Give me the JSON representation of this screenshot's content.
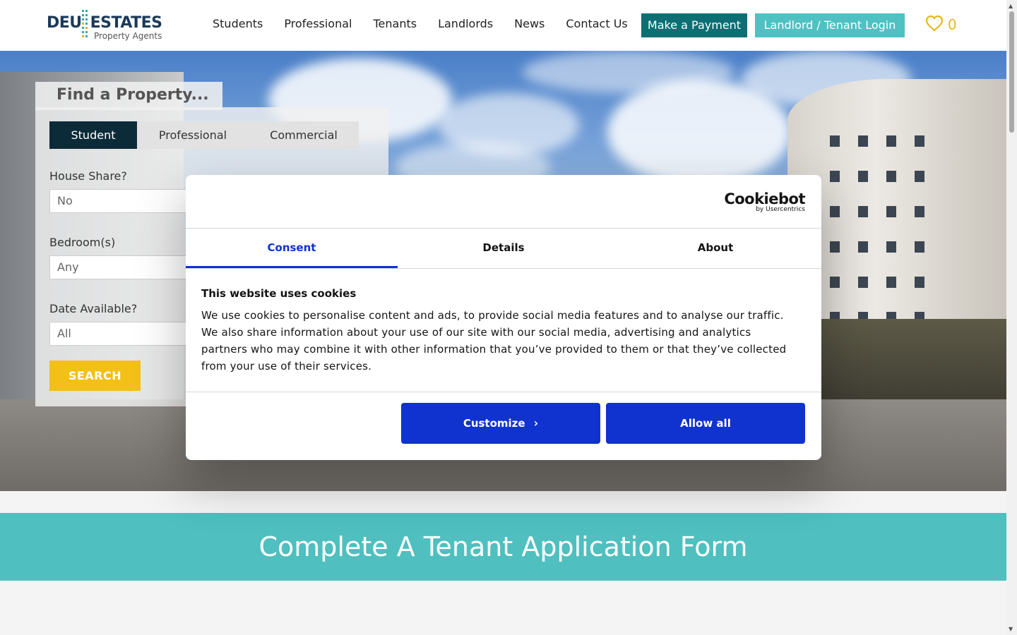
{
  "logo": {
    "left": "DEU",
    "right": "ESTATES",
    "subtitle": "Property Agents"
  },
  "nav": {
    "items": [
      "Students",
      "Professional",
      "Tenants",
      "Landlords",
      "News",
      "Contact Us"
    ],
    "pay_label": "Make a Payment",
    "login_label": "Landlord / Tenant Login",
    "favourites_count": "0"
  },
  "search": {
    "title": "Find a Property...",
    "tabs": [
      "Student",
      "Professional",
      "Commercial"
    ],
    "active_tab": "Student",
    "fields": [
      {
        "label": "House Share?",
        "value": "No"
      },
      {
        "label": "Bedroom(s)",
        "value": "Any"
      },
      {
        "label": "Date Available?",
        "value": "All"
      }
    ],
    "button_label": "SEARCH"
  },
  "band": {
    "title": "Complete A Tenant Application Form"
  },
  "cookie": {
    "brand": "Cookiebot",
    "brand_sub": "by Usercentrics",
    "tabs": [
      "Consent",
      "Details",
      "About"
    ],
    "active_tab": "Consent",
    "title": "This website uses cookies",
    "body": "We use cookies to personalise content and ads, to provide social media features and to analyse our traffic. We also share information about your use of our site with our social media, advertising and analytics partners who may combine it with other information that you’ve provided to them or that they’ve collected from your use of their services.",
    "customize_label": "Customize",
    "allow_label": "Allow all"
  },
  "colors": {
    "teal_dark": "#0d6e74",
    "teal_light": "#4fc1c2",
    "yellow": "#f2c017",
    "navy": "#0c2b38",
    "cookie_blue": "#1032cf"
  },
  "icons": {
    "favourite": "heart-icon",
    "customize_arrow": "chevron-right-icon"
  }
}
